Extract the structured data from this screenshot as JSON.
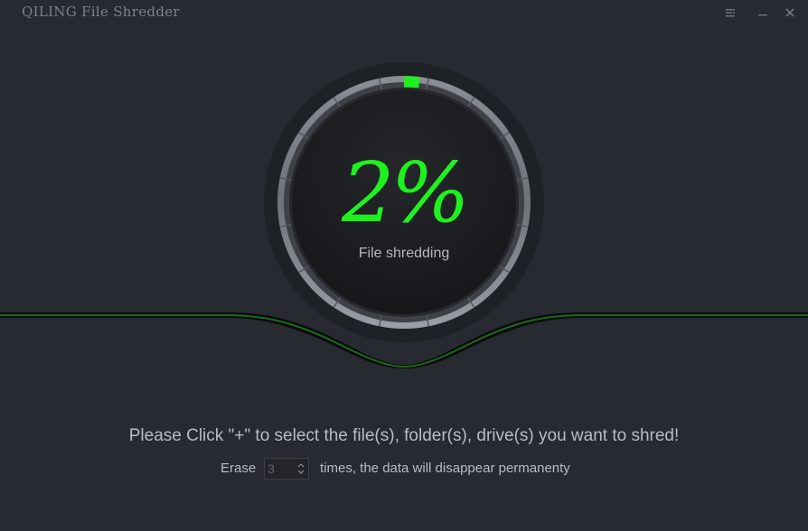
{
  "window": {
    "title": "QILING File Shredder"
  },
  "progress": {
    "percent_label": "2%",
    "value": 0.02,
    "status": "File shredding",
    "accent_color": "#1ef21e"
  },
  "instructions": {
    "text": "Please Click \"+\" to select the file(s), folder(s), drive(s) you want to shred!"
  },
  "erase": {
    "prefix": "Erase",
    "value": "3",
    "suffix": "times, the data will disappear permanenty"
  },
  "icons": {
    "menu": "menu-icon",
    "minimize": "minimize-icon",
    "close": "close-icon"
  }
}
